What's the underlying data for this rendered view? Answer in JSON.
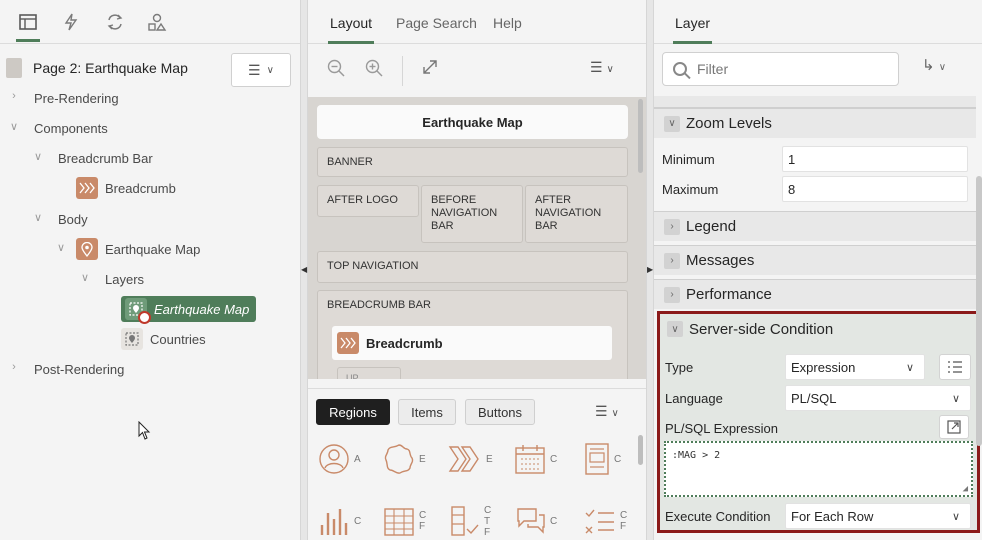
{
  "left": {
    "top_icons": [
      "page-tree-icon",
      "dynamic-actions-icon",
      "processing-icon",
      "shared-components-icon"
    ],
    "page_title": "Page 2: Earthquake Map",
    "tree": {
      "pre_rendering": "Pre-Rendering",
      "components": "Components",
      "breadcrumb_bar": "Breadcrumb Bar",
      "breadcrumb": "Breadcrumb",
      "body": "Body",
      "earthquake_map_region": "Earthquake Map",
      "layers": "Layers",
      "layer_earthquake": "Earthquake Map",
      "layer_countries": "Countries",
      "post_rendering": "Post-Rendering"
    }
  },
  "middle": {
    "tabs": [
      "Layout",
      "Page Search",
      "Help"
    ],
    "active_tab": "Layout",
    "canvas": {
      "title": "Earthquake Map",
      "banner": "BANNER",
      "after_logo": "AFTER LOGO",
      "before_navigation_bar": "BEFORE NAVIGATION BAR",
      "after_navigation_bar": "AFTER NAVIGATION BAR",
      "top_navigation": "TOP NAVIGATION",
      "breadcrumb_bar": "BREADCRUMB BAR",
      "breadcrumb_card": "Breadcrumb",
      "cut_slot": "UP"
    },
    "gallery": {
      "tabs": [
        "Regions",
        "Items",
        "Buttons"
      ],
      "active_tab": "Regions",
      "row1_labels": [
        "A",
        "E",
        "E",
        "C",
        "C"
      ],
      "row2_labels": [
        "C",
        "C F",
        "C T F",
        "C",
        "C F"
      ]
    }
  },
  "right": {
    "tab": "Layer",
    "filter_placeholder": "Filter",
    "sections": {
      "zoom_levels": "Zoom Levels",
      "legend": "Legend",
      "messages": "Messages",
      "performance": "Performance",
      "server_side_condition": "Server-side Condition"
    },
    "zoom": {
      "minimum_label": "Minimum",
      "minimum_value": "1",
      "maximum_label": "Maximum",
      "maximum_value": "8"
    },
    "ssc": {
      "type_label": "Type",
      "type_value": "Expression",
      "language_label": "Language",
      "language_value": "PL/SQL",
      "expression_label": "PL/SQL Expression",
      "expression_value": ":MAG > 2",
      "execute_label": "Execute Condition",
      "execute_value": "For Each Row"
    },
    "colors": {
      "accent_green": "#4f7d5a",
      "highlight_border": "#8b1a1a"
    }
  }
}
